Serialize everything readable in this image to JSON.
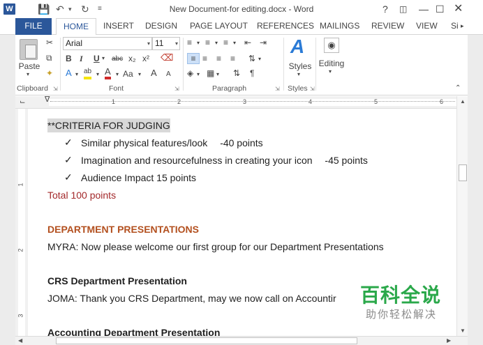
{
  "window": {
    "title": "New Document-for editing.docx - Word",
    "logo": "W",
    "help": "?",
    "controls": [
      "restore-ribbon-icon",
      "minimize-icon",
      "maximize-icon",
      "close-icon"
    ]
  },
  "tabs": [
    {
      "label": "FILE"
    },
    {
      "label": "HOME",
      "active": true
    },
    {
      "label": "INSERT"
    },
    {
      "label": "DESIGN"
    },
    {
      "label": "PAGE LAYOUT"
    },
    {
      "label": "REFERENCES"
    },
    {
      "label": "MAILINGS"
    },
    {
      "label": "REVIEW"
    },
    {
      "label": "VIEW"
    },
    {
      "label": "Si"
    }
  ],
  "ribbon": {
    "clipboard": {
      "paste": "Paste",
      "label": "Clipboard"
    },
    "font": {
      "name": "Arial",
      "size": "11",
      "label": "Font",
      "change_case": "Aa",
      "bold": "B",
      "italic": "I",
      "underline": "U",
      "strike": "abc",
      "subscript": "x₂",
      "superscript": "x²",
      "grow": "A",
      "shrink": "A",
      "text_effects": "A",
      "highlight": "ab",
      "font_color": "A"
    },
    "paragraph": {
      "label": "Paragraph"
    },
    "styles": {
      "label": "Styles",
      "button": "Styles"
    },
    "editing": {
      "button": "Editing"
    }
  },
  "ruler": {
    "numbers": [
      "1",
      "2",
      "3",
      "4",
      "5",
      "6"
    ],
    "vertical_numbers": [
      "1",
      "2",
      "3"
    ]
  },
  "document": {
    "criteria_heading": "**CRITERIA FOR JUDGING",
    "criteria": [
      {
        "text": "Similar physical features/look",
        "points": "-40 points"
      },
      {
        "text": "Imagination and resourcefulness in creating your icon",
        "points": "-45 points"
      },
      {
        "text": "Audience Impact 15 points",
        "points": ""
      }
    ],
    "check_mark": "✓",
    "total": "Total 100 points",
    "dept_heading": "DEPARTMENT PRESENTATIONS",
    "myra": "MYRA:   Now please welcome our first group for our Department Presentations",
    "crs_heading": "CRS Department Presentation",
    "joma": "JOMA: Thank you CRS Department, may we now call on Accountir",
    "acct_heading": "Accounting Department Presentation"
  },
  "watermark": {
    "main": "百科全说",
    "sub": "助你轻松解决"
  },
  "colors": {
    "accent": "#2b579a",
    "total_red": "#a3282a",
    "heading_orange": "#b3501f",
    "watermark_green": "#2aa84a"
  }
}
